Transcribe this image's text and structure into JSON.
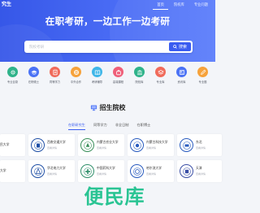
{
  "header": {
    "brand": "究生",
    "nav": [
      {
        "label": "首页",
        "active": true
      },
      {
        "label": "院校库",
        "active": false
      },
      {
        "label": "专业问题",
        "active": false
      }
    ]
  },
  "hero": {
    "headline": "在职考研，一边工作一边考研",
    "search_placeholder": "院校考研",
    "search_button": "搜索"
  },
  "categories": [
    {
      "label": "专业目录",
      "icon": "gear-icon",
      "color": "#2fb38a"
    },
    {
      "label": "在职硕士",
      "icon": "graduation-cap-icon",
      "color": "#4a72f5"
    },
    {
      "label": "同等学力",
      "icon": "document-icon",
      "color": "#f06b5b"
    },
    {
      "label": "中外合作",
      "icon": "globe-icon",
      "color": "#f6a23b"
    },
    {
      "label": "考研辅导",
      "icon": "book-icon",
      "color": "#3fb6e8"
    },
    {
      "label": "高端课程",
      "icon": "bag-icon",
      "color": "#ef5f79"
    },
    {
      "label": "院校库",
      "icon": "building-icon",
      "color": "#2fb38a"
    },
    {
      "label": "专业库",
      "icon": "layers-icon",
      "color": "#f06b5b"
    },
    {
      "label": "资讯库",
      "icon": "news-icon",
      "color": "#4a72f5"
    },
    {
      "label": "专业题",
      "icon": "pencil-icon",
      "color": "#f6a23b"
    }
  ],
  "section": {
    "title": "招生院校",
    "tabs": [
      {
        "label": "在职研究生",
        "active": true
      },
      {
        "label": "同等学力",
        "active": false
      },
      {
        "label": "非全日制",
        "active": false
      },
      {
        "label": "在职博士",
        "active": false
      }
    ]
  },
  "schools": [
    {
      "name": "民大学",
      "sub": "",
      "color": "#3c6bd6"
    },
    {
      "name": "西南交通大学",
      "sub": "查看详情",
      "color": "#1f4fa5"
    },
    {
      "name": "内蒙古农业大学",
      "sub": "查看详情",
      "color": "#3a8f5a"
    },
    {
      "name": "内蒙古科技大学",
      "sub": "查看详情",
      "color": "#2a5cbf"
    },
    {
      "name": "东北",
      "sub": "查看详情",
      "color": "#2a5cbf"
    },
    {
      "name": "大学",
      "sub": "",
      "color": "#3c6bd6"
    },
    {
      "name": "华北电力大学",
      "sub": "查看详情",
      "color": "#1f4fa5"
    },
    {
      "name": "中国药科大学",
      "sub": "查看详情",
      "color": "#2f8f6a"
    },
    {
      "name": "哈尔滨大学",
      "sub": "查看详情",
      "color": "#2a5cbf"
    },
    {
      "name": "天津",
      "sub": "查看详情",
      "color": "#3a4ea5"
    }
  ],
  "watermark": "便民库"
}
